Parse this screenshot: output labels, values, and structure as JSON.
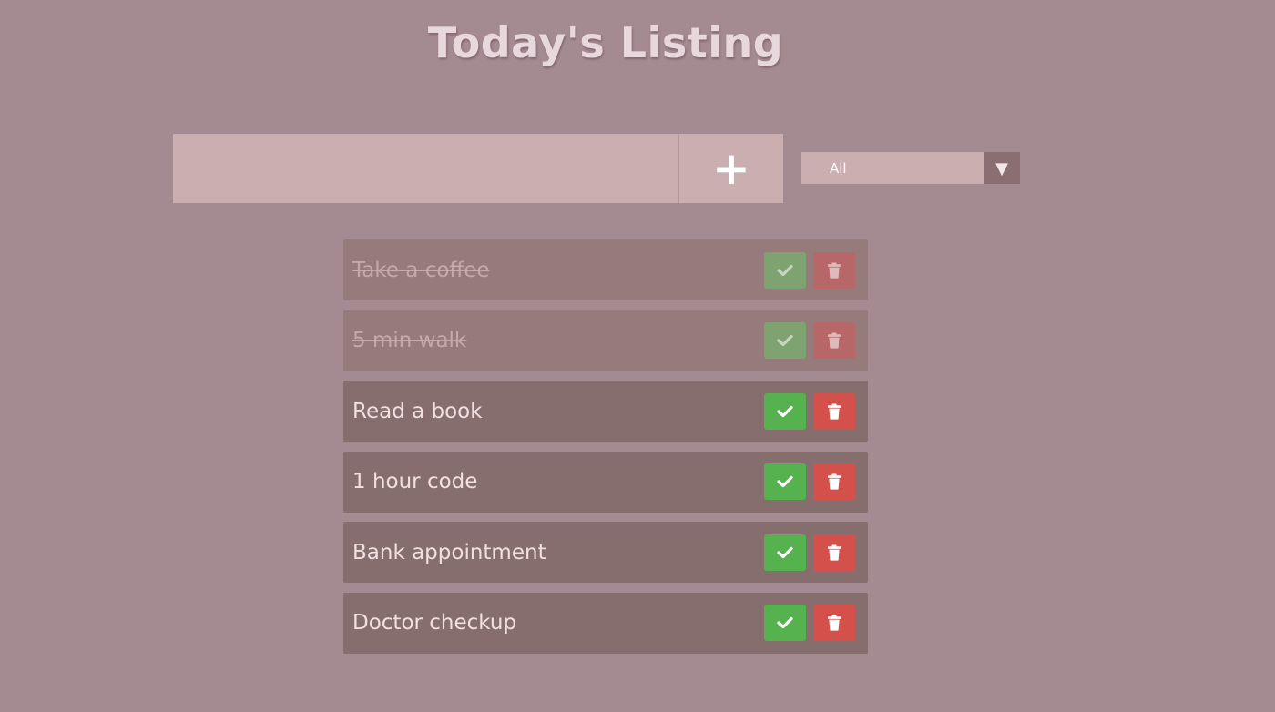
{
  "header": {
    "title": "Today's Listing"
  },
  "add_form": {
    "input_value": "",
    "input_placeholder": "",
    "add_icon": "plus-icon",
    "add_label": "+"
  },
  "filter": {
    "selected": "All",
    "arrow_icon": "dropdown-arrow-icon",
    "arrow_glyph": "▼"
  },
  "todos": [
    {
      "text": "Take a coffee",
      "completed": true
    },
    {
      "text": "5 min walk",
      "completed": true
    },
    {
      "text": "Read a book",
      "completed": false
    },
    {
      "text": "1 hour code",
      "completed": false
    },
    {
      "text": "Bank appointment",
      "completed": false
    },
    {
      "text": "Doctor checkup",
      "completed": false
    }
  ],
  "item_actions": {
    "complete_icon": "check-icon",
    "delete_icon": "trash-icon"
  },
  "colors": {
    "background": "#a48a91",
    "title": "#e8d7dc",
    "input": "#cbafb0",
    "item": "#866e6e",
    "item_done": "#957b7c",
    "check": "#55b24f",
    "trash": "#d4514b"
  }
}
